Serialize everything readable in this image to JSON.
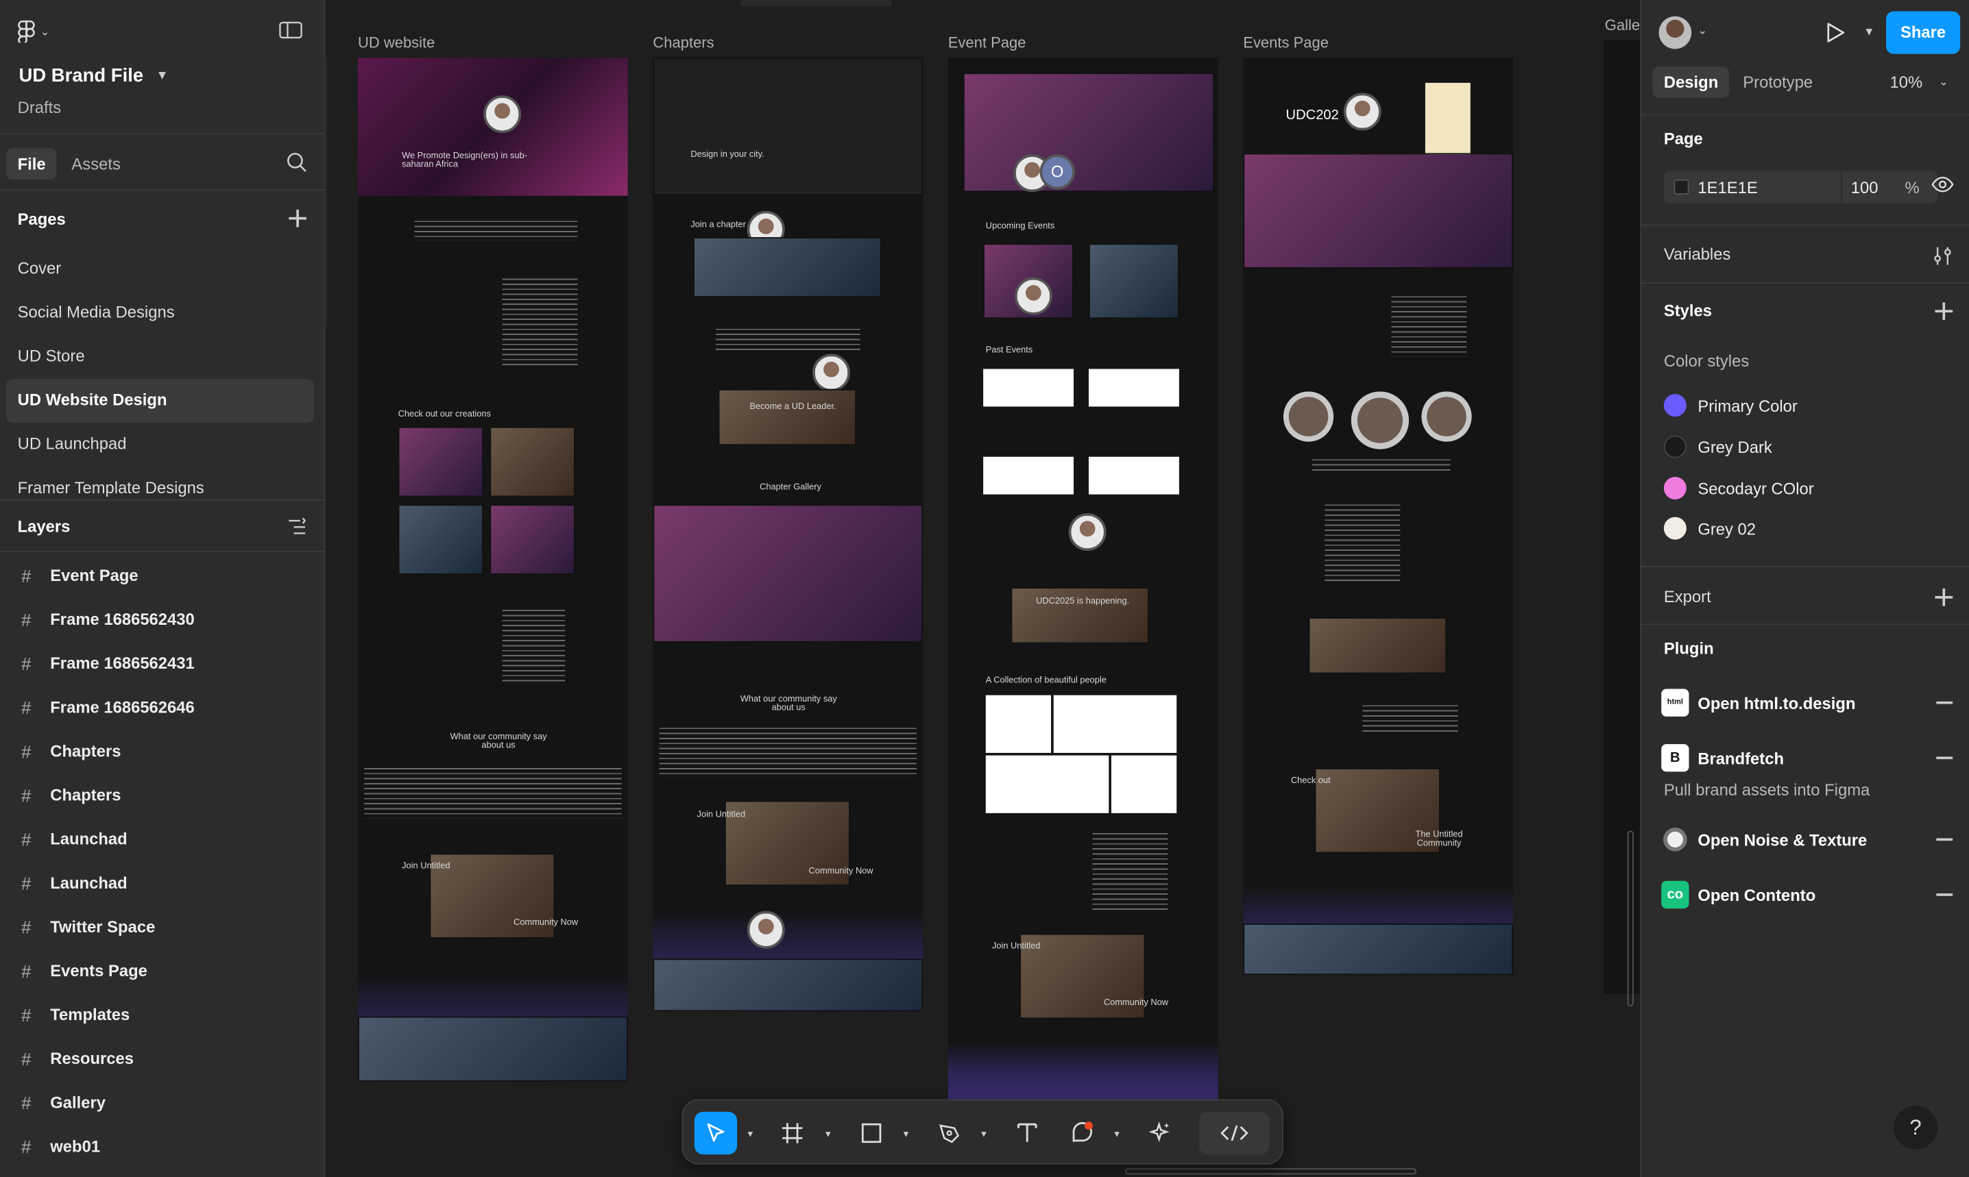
{
  "file": {
    "name": "UD Brand File",
    "location": "Drafts"
  },
  "left_tabs": {
    "file": "File",
    "assets": "Assets"
  },
  "pages": {
    "label": "Pages",
    "items": [
      "Cover",
      "Social Media Designs",
      "UD Store",
      "UD Website Design",
      "UD Launchpad",
      "Framer Template Designs"
    ],
    "active": "UD Website Design"
  },
  "layers": {
    "label": "Layers",
    "items": [
      "Event Page",
      "Frame 1686562430",
      "Frame 1686562431",
      "Frame 1686562646",
      "Chapters",
      "Chapters",
      "Launchad",
      "Launchad",
      "Twitter Space",
      "Events Page",
      "Templates",
      "Resources",
      "Gallery",
      "web01"
    ]
  },
  "canvas": {
    "frames": [
      {
        "label": "UD website"
      },
      {
        "label": "Chapters"
      },
      {
        "label": "Event Page"
      },
      {
        "label": "Events Page"
      }
    ],
    "cut_frame_label": "Galle",
    "frame_texts": {
      "ud_hero": "We Promote Design(ers) in sub-saharan Africa",
      "ud_creations": "Check out our creations",
      "ud_community": "What our community say about us",
      "ud_join": "Join Untitled",
      "ud_community_now": "Community Now",
      "ch_hero": "Design in your city.",
      "ch_join": "Join a chapter",
      "ch_leader": "Become a UD Leader.",
      "ch_gallery": "Chapter Gallery",
      "ch_community": "What our community say about us",
      "ch_join2": "Join Untitled",
      "ch_community_now": "Community Now",
      "ev_upcoming": "Upcoming Events",
      "ev_past": "Past Events",
      "ev_udc": "UDC2025 is happening.",
      "ev_collection": "A Collection of beautiful people",
      "ev_join": "Join Untitled",
      "ev_community_now": "Community Now",
      "eps_title": "UDC202",
      "eps_checkout": "Check out",
      "eps_untitled": "The Untitled Community"
    }
  },
  "toolbar": {
    "tools": [
      "move-tool",
      "frame-tool",
      "shape-tool",
      "pen-tool",
      "text-tool",
      "comment-tool",
      "actions-tool",
      "dev-mode-toggle"
    ],
    "active": "move-tool"
  },
  "right": {
    "share_label": "Share",
    "tabs": {
      "design": "Design",
      "prototype": "Prototype"
    },
    "zoom": "10%",
    "page": {
      "label": "Page",
      "fill_hex": "1E1E1E",
      "opacity": "100",
      "pct": "%"
    },
    "variables_label": "Variables",
    "styles_label": "Styles",
    "color_styles_label": "Color styles",
    "color_styles": [
      {
        "name": "Primary Color",
        "color": "#6b5cff"
      },
      {
        "name": "Grey Dark",
        "color": "#1a1a1a"
      },
      {
        "name": "Secodayr COlor",
        "color": "#f07ce0"
      },
      {
        "name": "Grey 02",
        "color": "#f2ede4"
      }
    ],
    "export_label": "Export",
    "plugin_label": "Plugin",
    "plugins": [
      {
        "name": "Open html.to.design",
        "icon": "html-to-design-icon"
      },
      {
        "name": "Brandfetch",
        "icon": "brandfetch-icon",
        "desc": "Pull brand assets into Figma"
      },
      {
        "name": "Open Noise & Texture",
        "icon": "noise-texture-icon"
      },
      {
        "name": "Open Contento",
        "icon": "contento-icon"
      }
    ],
    "help_label": "?"
  }
}
